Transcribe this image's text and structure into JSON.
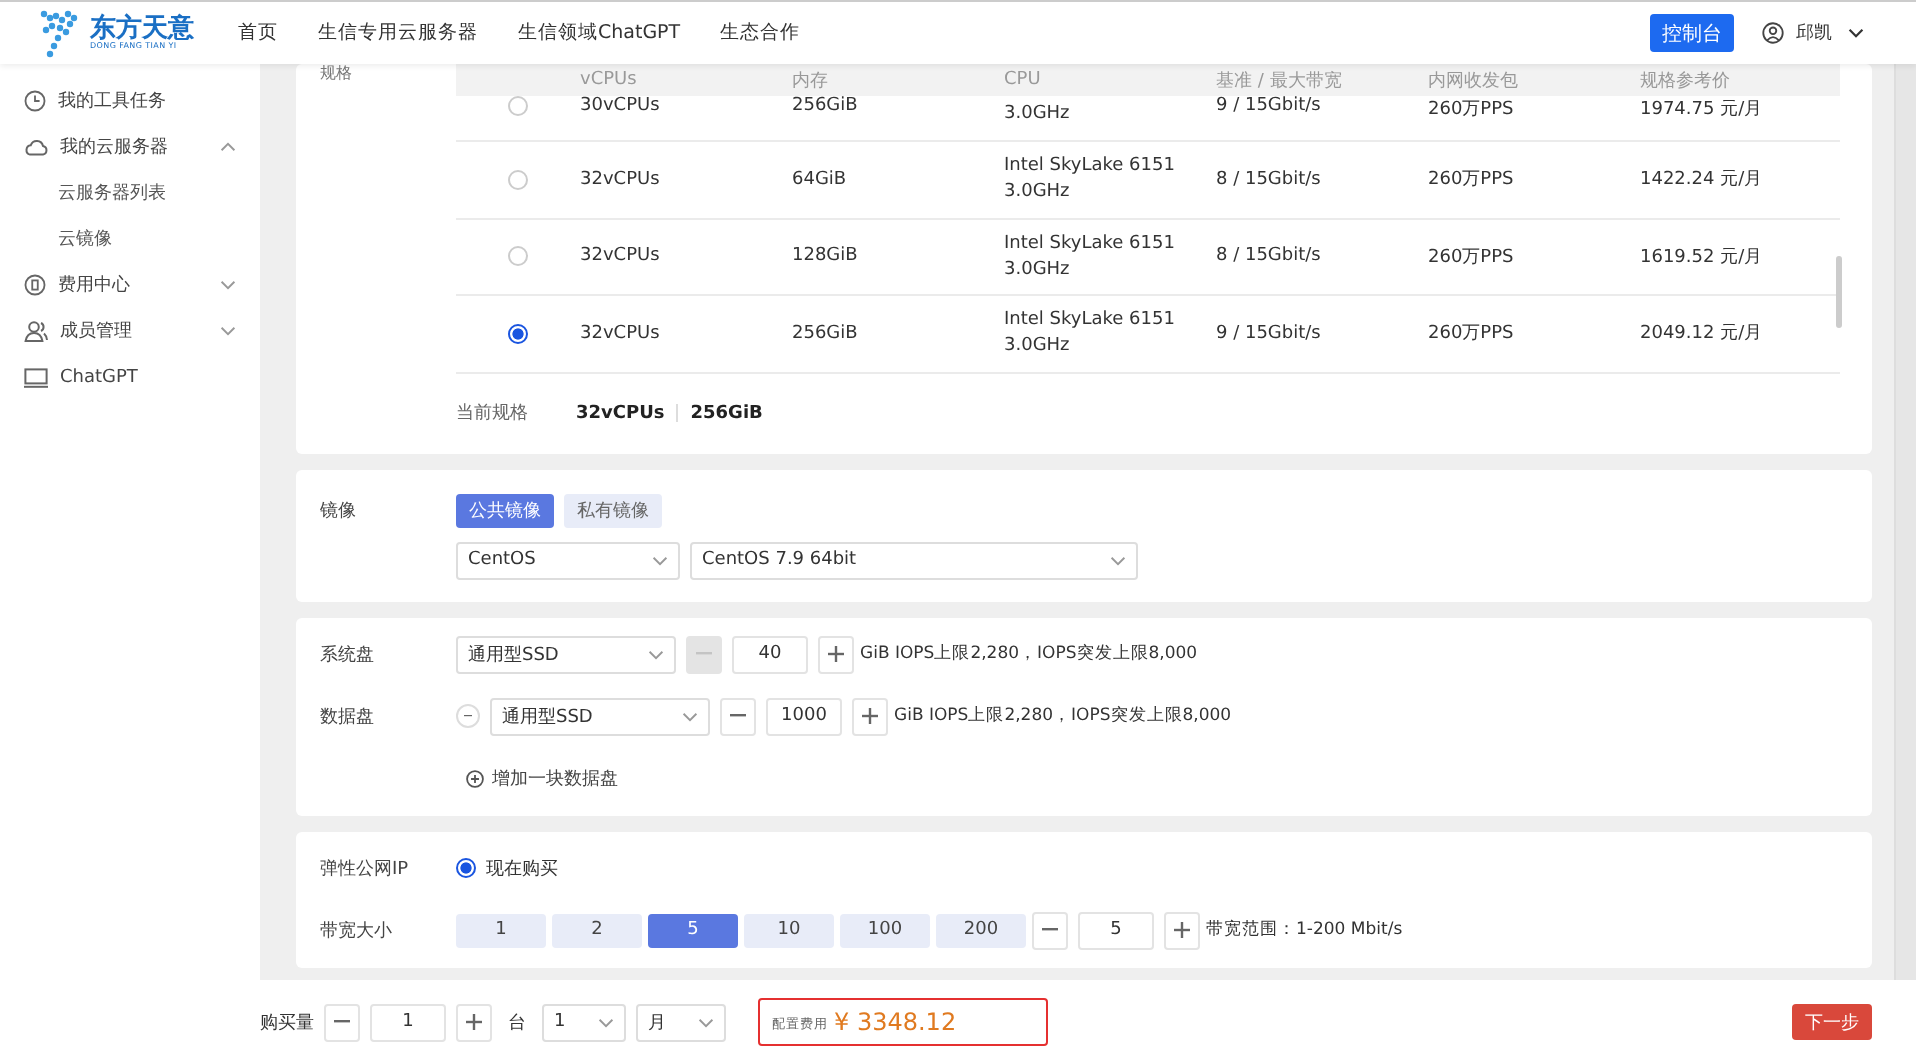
{
  "header": {
    "logo": {
      "name": "东方天意",
      "subtitle": "DONG FANG TIAN YI"
    },
    "nav": [
      "首页",
      "生信专用云服务器",
      "生信领域ChatGPT",
      "生态合作"
    ],
    "console_button": "控制台",
    "user": "邱凯"
  },
  "sidebar": {
    "items": [
      {
        "label": "我的工具任务"
      },
      {
        "label": "我的云服务器",
        "expanded": true,
        "children": [
          {
            "label": "云服务器列表"
          },
          {
            "label": "云镜像"
          }
        ]
      },
      {
        "label": "费用中心",
        "expanded": false
      },
      {
        "label": "成员管理",
        "expanded": false
      },
      {
        "label": "ChatGPT"
      }
    ]
  },
  "spec": {
    "label": "规格",
    "columns": [
      "vCPUs",
      "内存",
      "CPU",
      "基准 / 最大带宽",
      "内网收发包",
      "规格参考价"
    ],
    "rows": [
      {
        "selected": false,
        "vcpus": "30vCPUs",
        "memory": "256GiB",
        "cpu": [
          "3.0GHz"
        ],
        "bandwidth": "9 / 15Gbit/s",
        "pps": "260万PPS",
        "price": "1974.75 元/月"
      },
      {
        "selected": false,
        "vcpus": "32vCPUs",
        "memory": "64GiB",
        "cpu": [
          "Intel SkyLake 6151",
          "3.0GHz"
        ],
        "bandwidth": "8 / 15Gbit/s",
        "pps": "260万PPS",
        "price": "1422.24 元/月"
      },
      {
        "selected": false,
        "vcpus": "32vCPUs",
        "memory": "128GiB",
        "cpu": [
          "Intel SkyLake 6151",
          "3.0GHz"
        ],
        "bandwidth": "8 / 15Gbit/s",
        "pps": "260万PPS",
        "price": "1619.52 元/月"
      },
      {
        "selected": true,
        "vcpus": "32vCPUs",
        "memory": "256GiB",
        "cpu": [
          "Intel SkyLake 6151",
          "3.0GHz"
        ],
        "bandwidth": "9 / 15Gbit/s",
        "pps": "260万PPS",
        "price": "2049.12 元/月"
      }
    ],
    "current": {
      "label": "当前规格",
      "values": [
        "32vCPUs",
        "256GiB"
      ]
    }
  },
  "image": {
    "label": "镜像",
    "tabs": [
      {
        "label": "公共镜像",
        "selected": true
      },
      {
        "label": "私有镜像",
        "selected": false
      }
    ],
    "os": "CentOS",
    "version": "CentOS 7.9 64bit"
  },
  "disks": {
    "rows": [
      {
        "label": "系统盘",
        "removable": false,
        "type": "通用型SSD",
        "size": "40",
        "minus_disabled": true,
        "note": "GiB IOPS上限2,280，IOPS突发上限8,000"
      },
      {
        "label": "数据盘",
        "removable": true,
        "type": "通用型SSD",
        "size": "1000",
        "minus_disabled": false,
        "note": "GiB IOPS上限2,280，IOPS突发上限8,000"
      }
    ],
    "add": "增加一块数据盘"
  },
  "ip": {
    "label": "弹性公网IP",
    "option": {
      "label": "现在购买",
      "selected": true
    },
    "bandwidth_label": "带宽大小",
    "options": [
      {
        "label": "1",
        "selected": false
      },
      {
        "label": "2",
        "selected": false
      },
      {
        "label": "5",
        "selected": true
      },
      {
        "label": "10",
        "selected": false
      },
      {
        "label": "100",
        "selected": false
      },
      {
        "label": "200",
        "selected": false
      }
    ],
    "value": "5",
    "note": "带宽范围：1-200 Mbit/s"
  },
  "footer": {
    "quantity_label": "购买量",
    "quantity": "1",
    "unit": "台",
    "duration": "1",
    "period": "月",
    "price_label": "配置费用",
    "price": "¥ 3348.12",
    "next": "下一步"
  }
}
